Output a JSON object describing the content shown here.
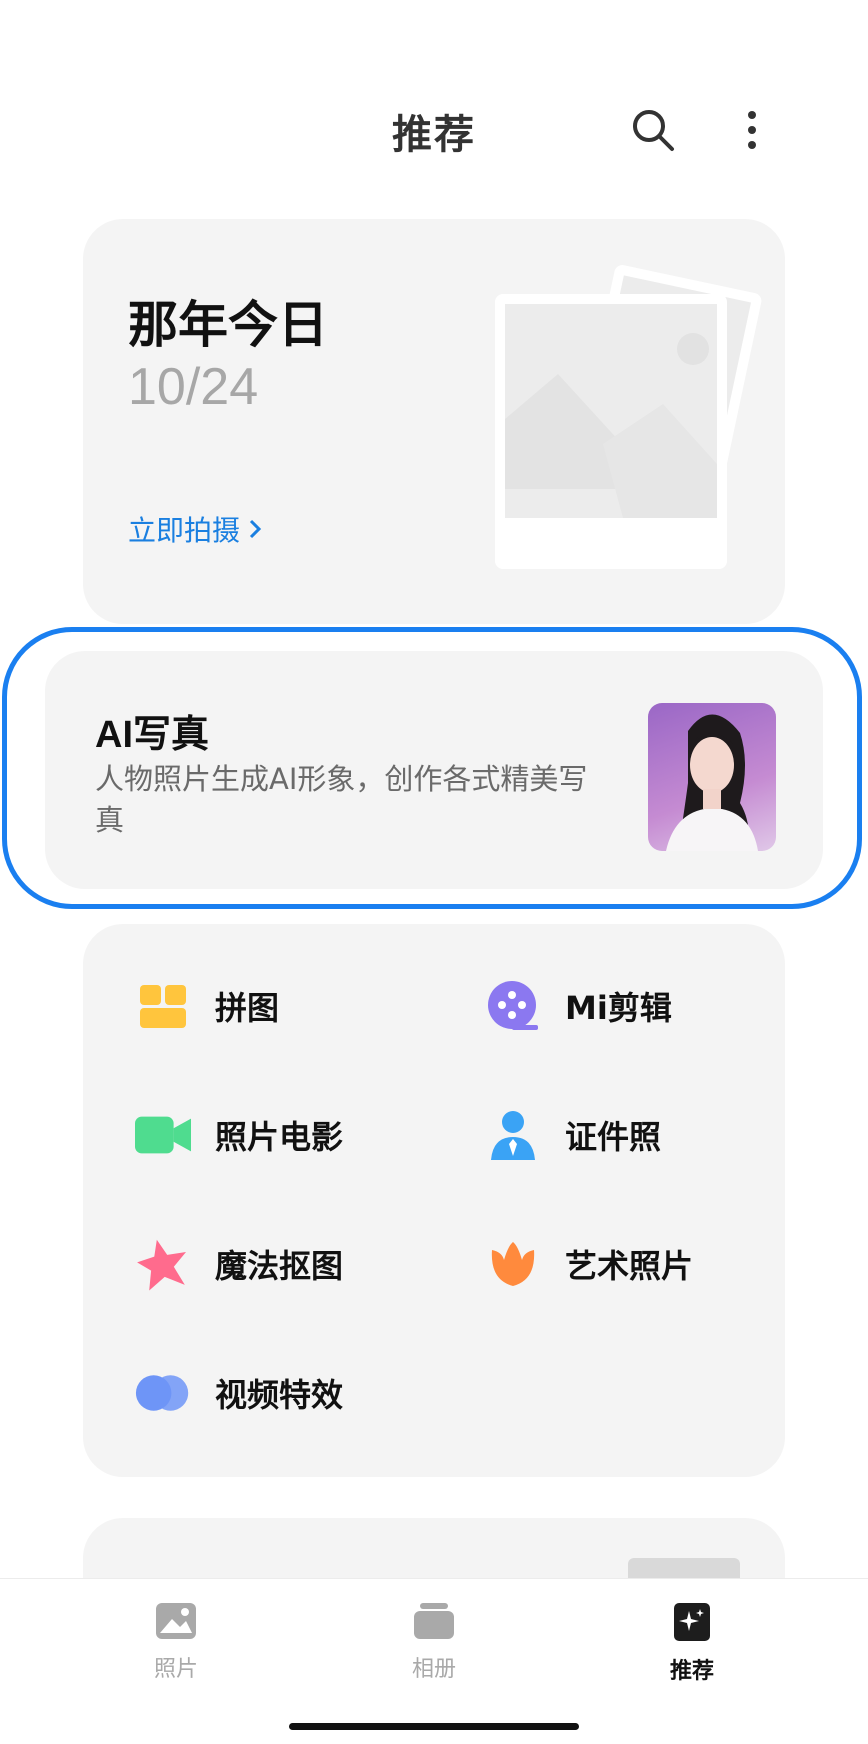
{
  "header": {
    "title": "推荐",
    "search_icon": "search-icon",
    "more_icon": "more-vertical-icon"
  },
  "memory_card": {
    "title": "那年今日",
    "date": "10/24",
    "action": "立即拍摄"
  },
  "ai_card": {
    "title": "AI写真",
    "description": "人物照片生成AI形象，创作各式精美写真"
  },
  "tools": [
    {
      "label": "拼图",
      "icon": "collage-icon",
      "color": "#ffc53d"
    },
    {
      "label": "Mi剪辑",
      "icon": "film-reel-icon",
      "color": "#8b78f0"
    },
    {
      "label": "照片电影",
      "icon": "video-camera-icon",
      "color": "#4fdc8f"
    },
    {
      "label": "证件照",
      "icon": "id-person-icon",
      "color": "#3aa3f5"
    },
    {
      "label": "魔法抠图",
      "icon": "star-cutout-icon",
      "color": "#ff6b8d"
    },
    {
      "label": "艺术照片",
      "icon": "tulip-icon",
      "color": "#ff8a3d"
    },
    {
      "label": "视频特效",
      "icon": "overlap-circles-icon",
      "color": "#6e95f7"
    }
  ],
  "tabbar": [
    {
      "label": "照片",
      "icon": "photo-icon",
      "active": false
    },
    {
      "label": "相册",
      "icon": "album-icon",
      "active": false
    },
    {
      "label": "推荐",
      "icon": "sparkle-icon",
      "active": true
    }
  ]
}
